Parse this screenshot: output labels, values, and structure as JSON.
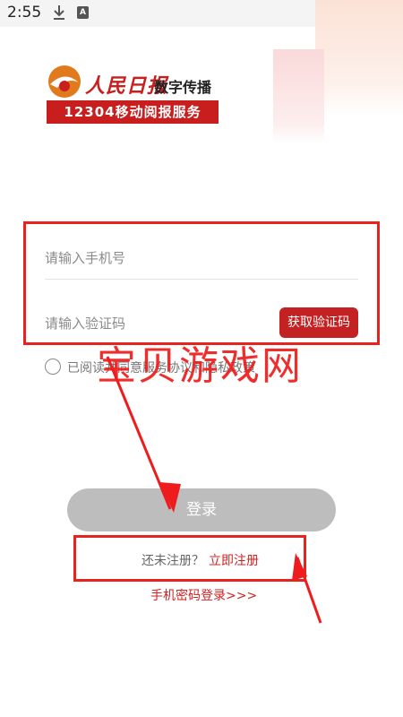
{
  "status_bar": {
    "time": "2:55",
    "icons": [
      "download-icon",
      "app-notification-icon",
      "wifi-icon",
      "signal-icon",
      "battery-icon"
    ],
    "notification_glyph": "A"
  },
  "header": {
    "logo_name": "人民日报",
    "logo_subtitle": "数字传播",
    "banner_text": "12304移动阅报服务"
  },
  "form": {
    "phone_placeholder": "请输入手机号",
    "phone_value": "",
    "code_placeholder": "请输入验证码",
    "code_value": "",
    "get_code_label": "获取验证码",
    "agreement_text": "已阅读并同意服务协议和隐私政策",
    "agreement_checked": false
  },
  "watermark": "宝贝游戏网",
  "actions": {
    "login_label": "登录",
    "register_prompt": "还未注册？",
    "register_link": "立即注册",
    "password_login_link": "手机密码登录>>>"
  },
  "colors": {
    "brand_red": "#c81e1e",
    "annotation_red": "#e8231e",
    "disabled_button": "#bdbdbd"
  }
}
